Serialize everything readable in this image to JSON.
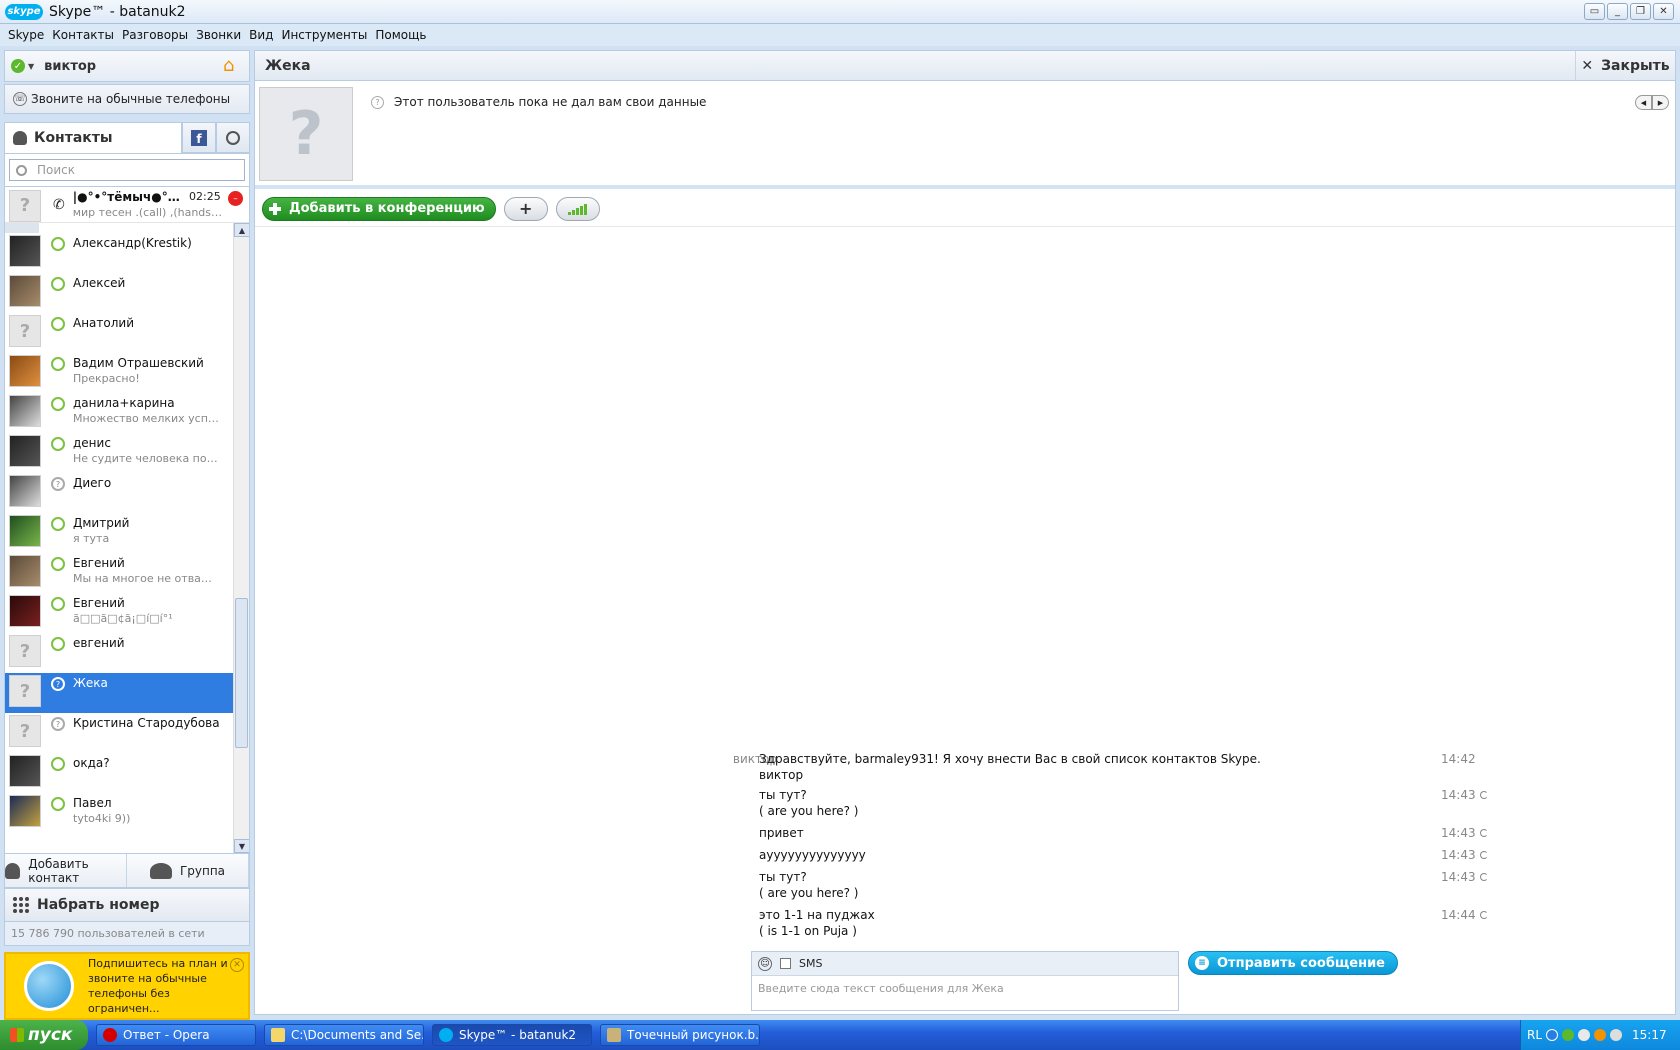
{
  "window": {
    "logo": "skype",
    "title": "Skype™ - batanuk2"
  },
  "menu": [
    "Skype",
    "Контакты",
    "Разговоры",
    "Звонки",
    "Вид",
    "Инструменты",
    "Помощь"
  ],
  "user": {
    "name": "виктор",
    "status_color": "#5cb82c"
  },
  "call_phones": "Звоните на обычные телефоны",
  "tabs": {
    "contacts": "Контакты",
    "facebook": "f"
  },
  "search": {
    "placeholder": "Поиск"
  },
  "active_call": {
    "name": "|●°•°тёмыч●°•°...",
    "time": "02:25",
    "mood": "мир тесен .(call) ,(handshake), (..."
  },
  "contacts": [
    {
      "name": "Александр(Krestik)",
      "mood": ""
    },
    {
      "name": "Алексей",
      "mood": ""
    },
    {
      "name": "Анатолий",
      "mood": ""
    },
    {
      "name": "Вадим Отрашевский",
      "mood": "Прекрасно!"
    },
    {
      "name": "данила+карина",
      "mood": "Множество мелких успехов..."
    },
    {
      "name": "денис",
      "mood": "Не судите человека пока н..."
    },
    {
      "name": "Диего",
      "mood": ""
    },
    {
      "name": "Дмитрий",
      "mood": "я тута"
    },
    {
      "name": "Евгений",
      "mood": "Мы на многое не отваживае..."
    },
    {
      "name": "Евгений",
      "mood": "ã□□ã□¢ã¡□í□í°¹"
    },
    {
      "name": "евгений",
      "mood": ""
    },
    {
      "name": "Жека",
      "mood": ""
    },
    {
      "name": "Кристина Стародубова",
      "mood": ""
    },
    {
      "name": "окда?",
      "mood": ""
    },
    {
      "name": "Павел",
      "mood": "tyto4ki 9))"
    }
  ],
  "bottom": {
    "add_contact": "Добавить контакт",
    "group": "Группа",
    "dial": "Набрать номер",
    "online": "15 786 790 пользователей в сети"
  },
  "promo": {
    "text": "Подпишитесь на план и звоните на обычные телефоны без ограничен..."
  },
  "conversation": {
    "name": "Жека",
    "close": "Закрыть",
    "profile_msg": "Этот пользователь пока не дал вам свои данные",
    "add_conf": "Добавить в конференцию",
    "messages": [
      {
        "sender": "виктор",
        "line1": "Здравствуйте, barmaley931! Я хочу внести Вас в свой список контактов Skype.",
        "line2": "виктор",
        "time": "14:42"
      },
      {
        "sender": "",
        "line1": "ты тут?",
        "line2": "( are you here? )",
        "time": "14:43"
      },
      {
        "sender": "",
        "line1": "привет",
        "line2": "",
        "time": "14:43"
      },
      {
        "sender": "",
        "line1": "ayyyyyyyyyyyyyy",
        "line2": "",
        "time": "14:43"
      },
      {
        "sender": "",
        "line1": "ты тут?",
        "line2": "( are you here? )",
        "time": "14:43"
      },
      {
        "sender": "",
        "line1": "это 1-1 на пуджах",
        "line2": "( is 1-1 on Puja )",
        "time": "14:44"
      }
    ],
    "sms": "SMS",
    "input_placeholder": "Введите сюда текст сообщения для Жека",
    "send": "Отправить сообщение"
  },
  "taskbar": {
    "start": "пуск",
    "tasks": [
      "Ответ - Opera",
      "C:\\Documents and Se...",
      "Skype™ - batanuk2",
      "Точечный рисунок.b..."
    ],
    "lang": "RL",
    "clock": "15:17"
  }
}
